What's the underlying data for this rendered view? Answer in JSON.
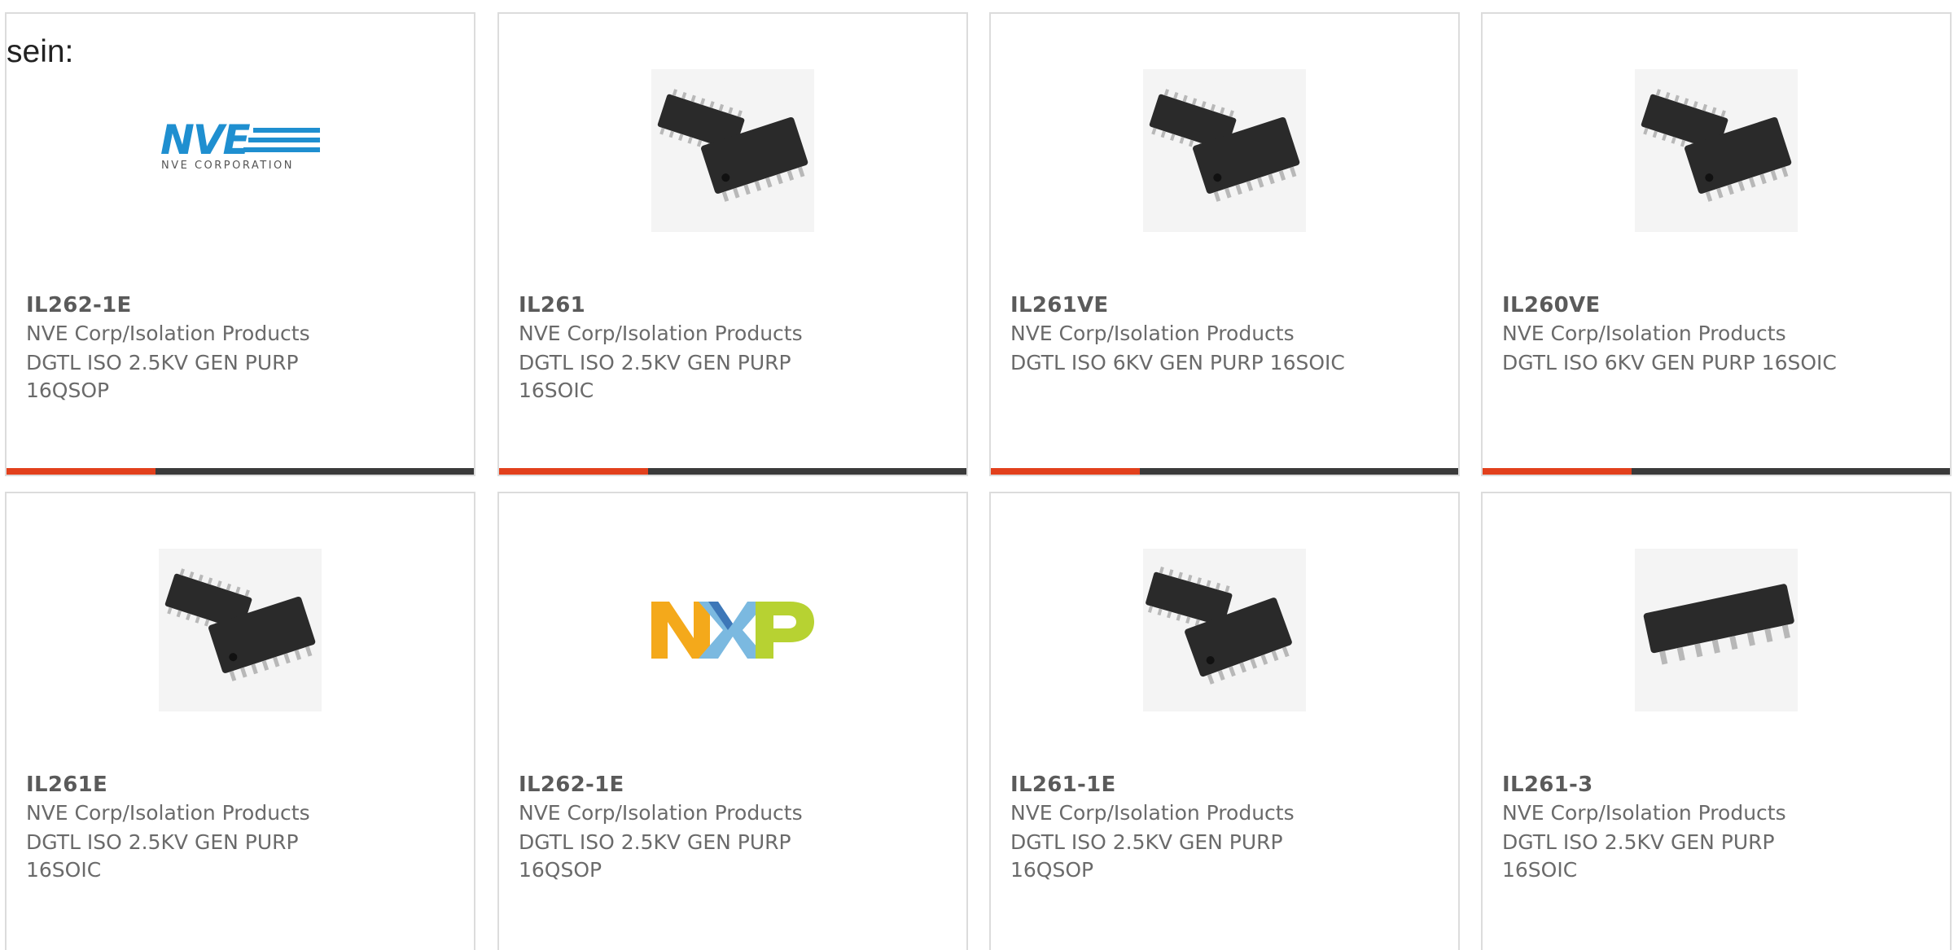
{
  "intro_text": "sein:",
  "colors": {
    "accent": "#e2401c",
    "bar": "#3a3a3a",
    "card_border": "#dcdcdc",
    "nve_blue": "#1f8fd0"
  },
  "products": [
    {
      "part": "IL262-1E",
      "manufacturer": "NVE Corp/Isolation Products",
      "description": "DGTL ISO 2.5KV GEN PURP 16QSOP",
      "image": "nve-logo",
      "logo_text": "NVE",
      "logo_subtext": "NVE CORPORATION"
    },
    {
      "part": "IL261",
      "manufacturer": "NVE Corp/Isolation Products",
      "description": "DGTL ISO 2.5KV GEN PURP 16SOIC",
      "image": "chip-pair-icon"
    },
    {
      "part": "IL261VE",
      "manufacturer": "NVE Corp/Isolation Products",
      "description": "DGTL ISO 6KV GEN PURP 16SOIC",
      "image": "chip-pair-icon"
    },
    {
      "part": "IL260VE",
      "manufacturer": "NVE Corp/Isolation Products",
      "description": "DGTL ISO 6KV GEN PURP 16SOIC",
      "image": "chip-pair-icon"
    },
    {
      "part": "IL261E",
      "manufacturer": "NVE Corp/Isolation Products",
      "description": "DGTL ISO 2.5KV GEN PURP 16SOIC",
      "image": "chip-pair-icon"
    },
    {
      "part": "IL262-1E",
      "manufacturer": "NVE Corp/Isolation Products",
      "description": "DGTL ISO 2.5KV GEN PURP 16QSOP",
      "image": "nxp-logo"
    },
    {
      "part": "IL261-1E",
      "manufacturer": "NVE Corp/Isolation Products",
      "description": "DGTL ISO 2.5KV GEN PURP 16QSOP",
      "image": "chip-pair-icon"
    },
    {
      "part": "IL261-3",
      "manufacturer": "NVE Corp/Isolation Products",
      "description": "DGTL ISO 2.5KV GEN PURP 16SOIC",
      "image": "single-chip-icon"
    }
  ]
}
